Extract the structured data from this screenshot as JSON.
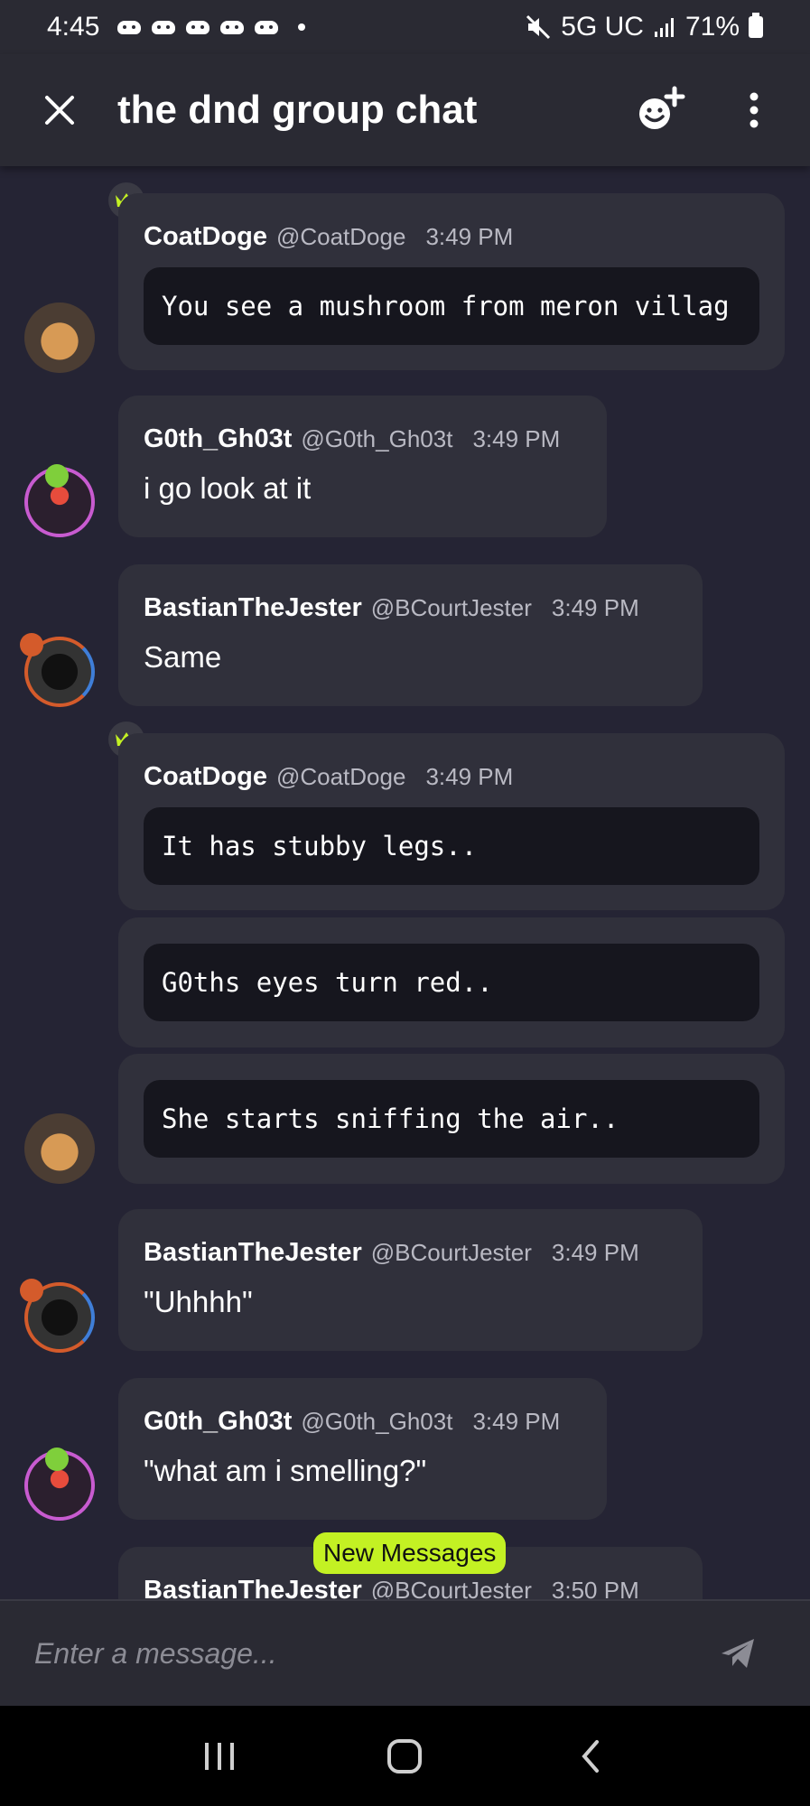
{
  "status_bar": {
    "time": "4:45",
    "network": "5G UC",
    "battery": "71%",
    "icons": [
      "discord-notification-icon",
      "discord-notification-icon",
      "discord-notification-icon",
      "discord-notification-icon",
      "discord-notification-icon",
      "mute-icon",
      "signal-icon",
      "battery-icon"
    ]
  },
  "header": {
    "title": "the dnd group chat",
    "close_icon": "close-icon",
    "add_reaction_icon": "emoji-add-icon",
    "more_icon": "more-vertical-icon"
  },
  "messages": [
    {
      "author": "CoatDoge",
      "handle": "@CoatDoge",
      "time": "3:49 PM",
      "code": "You see a mushroom from meron villag",
      "crown": true
    },
    {
      "author": "G0th_Gh03t",
      "handle": "@G0th_Gh03t",
      "time": "3:49 PM",
      "text": "i go look at it"
    },
    {
      "author": "BastianTheJester",
      "handle": "@BCourtJester",
      "time": "3:49 PM",
      "text": "Same"
    },
    {
      "author": "CoatDoge",
      "handle": "@CoatDoge",
      "time": "3:49 PM",
      "code": "It has stubby legs..",
      "crown": true
    },
    {
      "code": "G0ths eyes turn red.."
    },
    {
      "code": "She starts sniffing the air.."
    },
    {
      "author": "BastianTheJester",
      "handle": "@BCourtJester",
      "time": "3:49 PM",
      "text": "\"Uhhhh\""
    },
    {
      "author": "G0th_Gh03t",
      "handle": "@G0th_Gh03t",
      "time": "3:49 PM",
      "text": "\"what am i smelling?\""
    },
    {
      "author": "BastianTheJester",
      "handle": "@BCourtJester",
      "time": "3:50 PM"
    }
  ],
  "new_messages_label": "New Messages",
  "composer": {
    "placeholder": "Enter a message...",
    "send_icon": "send-icon"
  },
  "nav_bar": {
    "icons": [
      "recent-apps-icon",
      "home-icon",
      "back-icon"
    ]
  },
  "colors": {
    "background": "#252434",
    "bubble": "#30303b",
    "code_block": "#16161e",
    "new_messages_pill": "#c3f123"
  }
}
